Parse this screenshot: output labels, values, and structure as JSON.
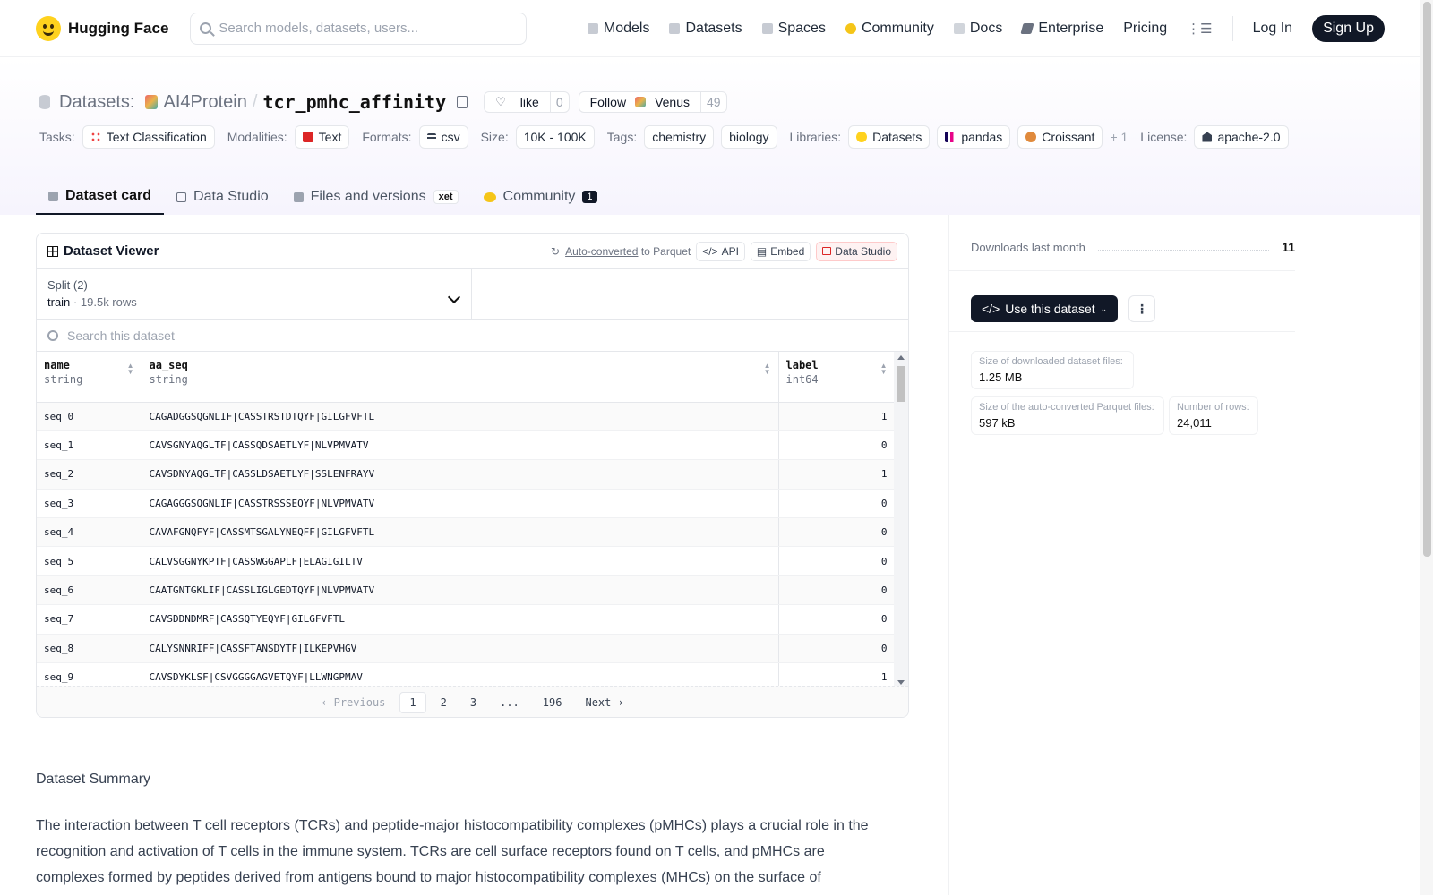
{
  "nav": {
    "brand": "Hugging Face",
    "search_placeholder": "Search models, datasets, users...",
    "links": [
      "Models",
      "Datasets",
      "Spaces",
      "Community",
      "Docs",
      "Enterprise",
      "Pricing"
    ],
    "login": "Log In",
    "signup": "Sign Up"
  },
  "header": {
    "section": "Datasets:",
    "org": "AI4Protein",
    "sep": "/",
    "name": "tcr_pmhc_affinity",
    "like_label": "like",
    "like_count": "0",
    "follow_label": "Follow",
    "follow_org": "Venus",
    "follow_count": "49",
    "tags": {
      "tasks_label": "Tasks:",
      "task": "Text Classification",
      "modalities_label": "Modalities:",
      "modality": "Text",
      "formats_label": "Formats:",
      "format": "csv",
      "size_label": "Size:",
      "size": "10K - 100K",
      "tags_label": "Tags:",
      "tag1": "chemistry",
      "tag2": "biology",
      "libraries_label": "Libraries:",
      "lib1": "Datasets",
      "lib2": "pandas",
      "lib3": "Croissant",
      "more": "+ 1",
      "license_label": "License:",
      "license": "apache-2.0"
    }
  },
  "tabs": {
    "card": "Dataset card",
    "studio": "Data Studio",
    "files": "Files and versions",
    "xet": "xet",
    "community": "Community",
    "community_count": "1"
  },
  "viewer": {
    "title": "Dataset Viewer",
    "autoconv": "Auto-converted",
    "autoconv_suffix": "to Parquet",
    "api": "API",
    "embed": "Embed",
    "studio": "Data Studio",
    "split_label": "Split (2)",
    "split_value": "train",
    "split_dot": "·",
    "split_rows": "19.5k rows",
    "search_placeholder": "Search this dataset",
    "columns": [
      {
        "name": "name",
        "type": "string"
      },
      {
        "name": "aa_seq",
        "type": "string"
      },
      {
        "name": "label",
        "type": "int64"
      }
    ],
    "rows": [
      [
        "seq_0",
        "CAGADGGSQGNLIF|CASSTRSTDTQYF|GILGFVFTL",
        "1"
      ],
      [
        "seq_1",
        "CAVSGNYAQGLTF|CASSQDSAETLYF|NLVPMVATV",
        "0"
      ],
      [
        "seq_2",
        "CAVSDNYAQGLTF|CASSLDSAETLYF|SSLENFRAYV",
        "1"
      ],
      [
        "seq_3",
        "CAGAGGGSQGNLIF|CASSTRSSSEQYF|NLVPMVATV",
        "0"
      ],
      [
        "seq_4",
        "CAVAFGNQFYF|CASSMTSGALYNEQFF|GILGFVFTL",
        "0"
      ],
      [
        "seq_5",
        "CALVSGGNYKPTF|CASSWGGAPLF|ELAGIGILTV",
        "0"
      ],
      [
        "seq_6",
        "CAATGNTGKLIF|CASSLIGLGEDTQYF|NLVPMVATV",
        "0"
      ],
      [
        "seq_7",
        "CAVSDDNDMRF|CASSQTYEQYF|GILGFVFTL",
        "0"
      ],
      [
        "seq_8",
        "CALYSNNRIFF|CASSFTANSDYTF|ILKEPVHGV",
        "0"
      ],
      [
        "seq_9",
        "CAVSDYKLSF|CSVGGGGAGVETQYF|LLWNGPMAV",
        "1"
      ]
    ],
    "pager": {
      "prev": "Previous",
      "p1": "1",
      "p2": "2",
      "p3": "3",
      "ellipsis": "...",
      "last": "196",
      "next": "Next"
    }
  },
  "summary": {
    "title": "Dataset Summary",
    "text": "The interaction between T cell receptors (TCRs) and peptide-major histocompatibility complexes (pMHCs) plays a crucial role in the recognition and activation of T cells in the immune system. TCRs are cell surface receptors found on T cells, and pMHCs are complexes formed by peptides derived from antigens bound to major histocompatibility complexes (MHCs) on the surface of"
  },
  "sidebar": {
    "downloads_label": "Downloads last month",
    "downloads_value": "11",
    "use_button": "Use this dataset",
    "stats": {
      "dl_size_label": "Size of downloaded dataset files:",
      "dl_size": "1.25 MB",
      "parquet_label": "Size of the auto-converted Parquet files:",
      "parquet": "597 kB",
      "rows_label": "Number of rows:",
      "rows": "24,011"
    }
  }
}
